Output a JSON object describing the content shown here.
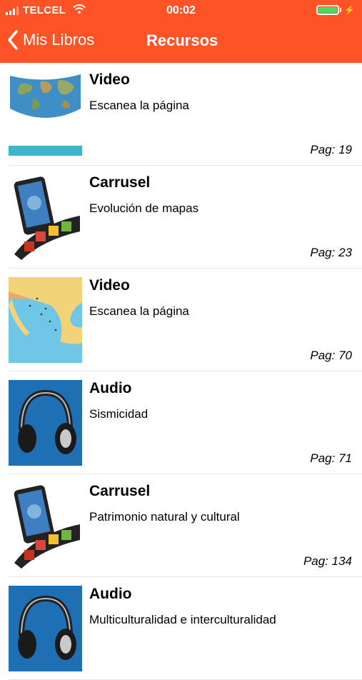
{
  "status": {
    "carrier": "TELCEL",
    "time": "00:02",
    "battery_color": "#4cd964"
  },
  "nav": {
    "back_label": "Mis Libros",
    "title": "Recursos",
    "color": "#fd5327"
  },
  "resources": [
    {
      "type": "Video",
      "description": "Escanea la página",
      "page": "Pag: 19",
      "thumb": "world-map"
    },
    {
      "type": "Carrusel",
      "description": "Evolución de mapas",
      "page": "Pag: 23",
      "thumb": "phone-filmstrip"
    },
    {
      "type": "Video",
      "description": "Escanea la página",
      "page": "Pag: 70",
      "thumb": "mexico-map"
    },
    {
      "type": "Audio",
      "description": "Sismicidad",
      "page": "Pag: 71",
      "thumb": "headphones"
    },
    {
      "type": "Carrusel",
      "description": "Patrimonio natural y cultural",
      "page": "Pag: 134",
      "thumb": "phone-filmstrip"
    },
    {
      "type": "Audio",
      "description": "Multiculturalidad e interculturalidad",
      "page": "",
      "thumb": "headphones"
    }
  ]
}
